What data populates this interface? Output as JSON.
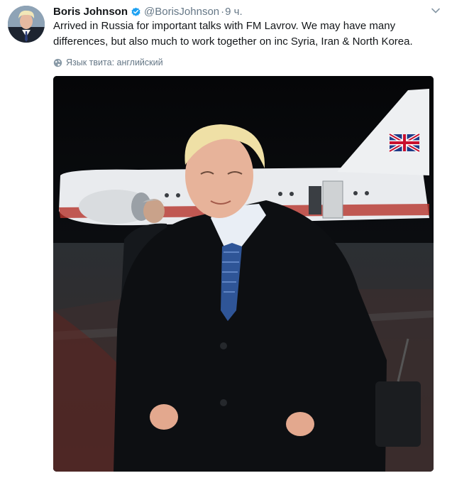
{
  "tweet": {
    "author_name": "Boris Johnson",
    "handle": "@BorisJohnson",
    "separator": "·",
    "time": "9 ч.",
    "text": "Arrived in Russia for important talks with FM Lavrov. We may have many differences, but also much to work together on inc Syria, Iran & North Korea.",
    "language_label": "Язык твита: английский"
  },
  "icons": {
    "verified": "verified-badge-icon",
    "more": "chevron-down-icon",
    "language": "globe-icon"
  },
  "colors": {
    "verified_blue": "#1da1f2",
    "secondary_text": "#657786",
    "primary_text": "#14171a"
  }
}
